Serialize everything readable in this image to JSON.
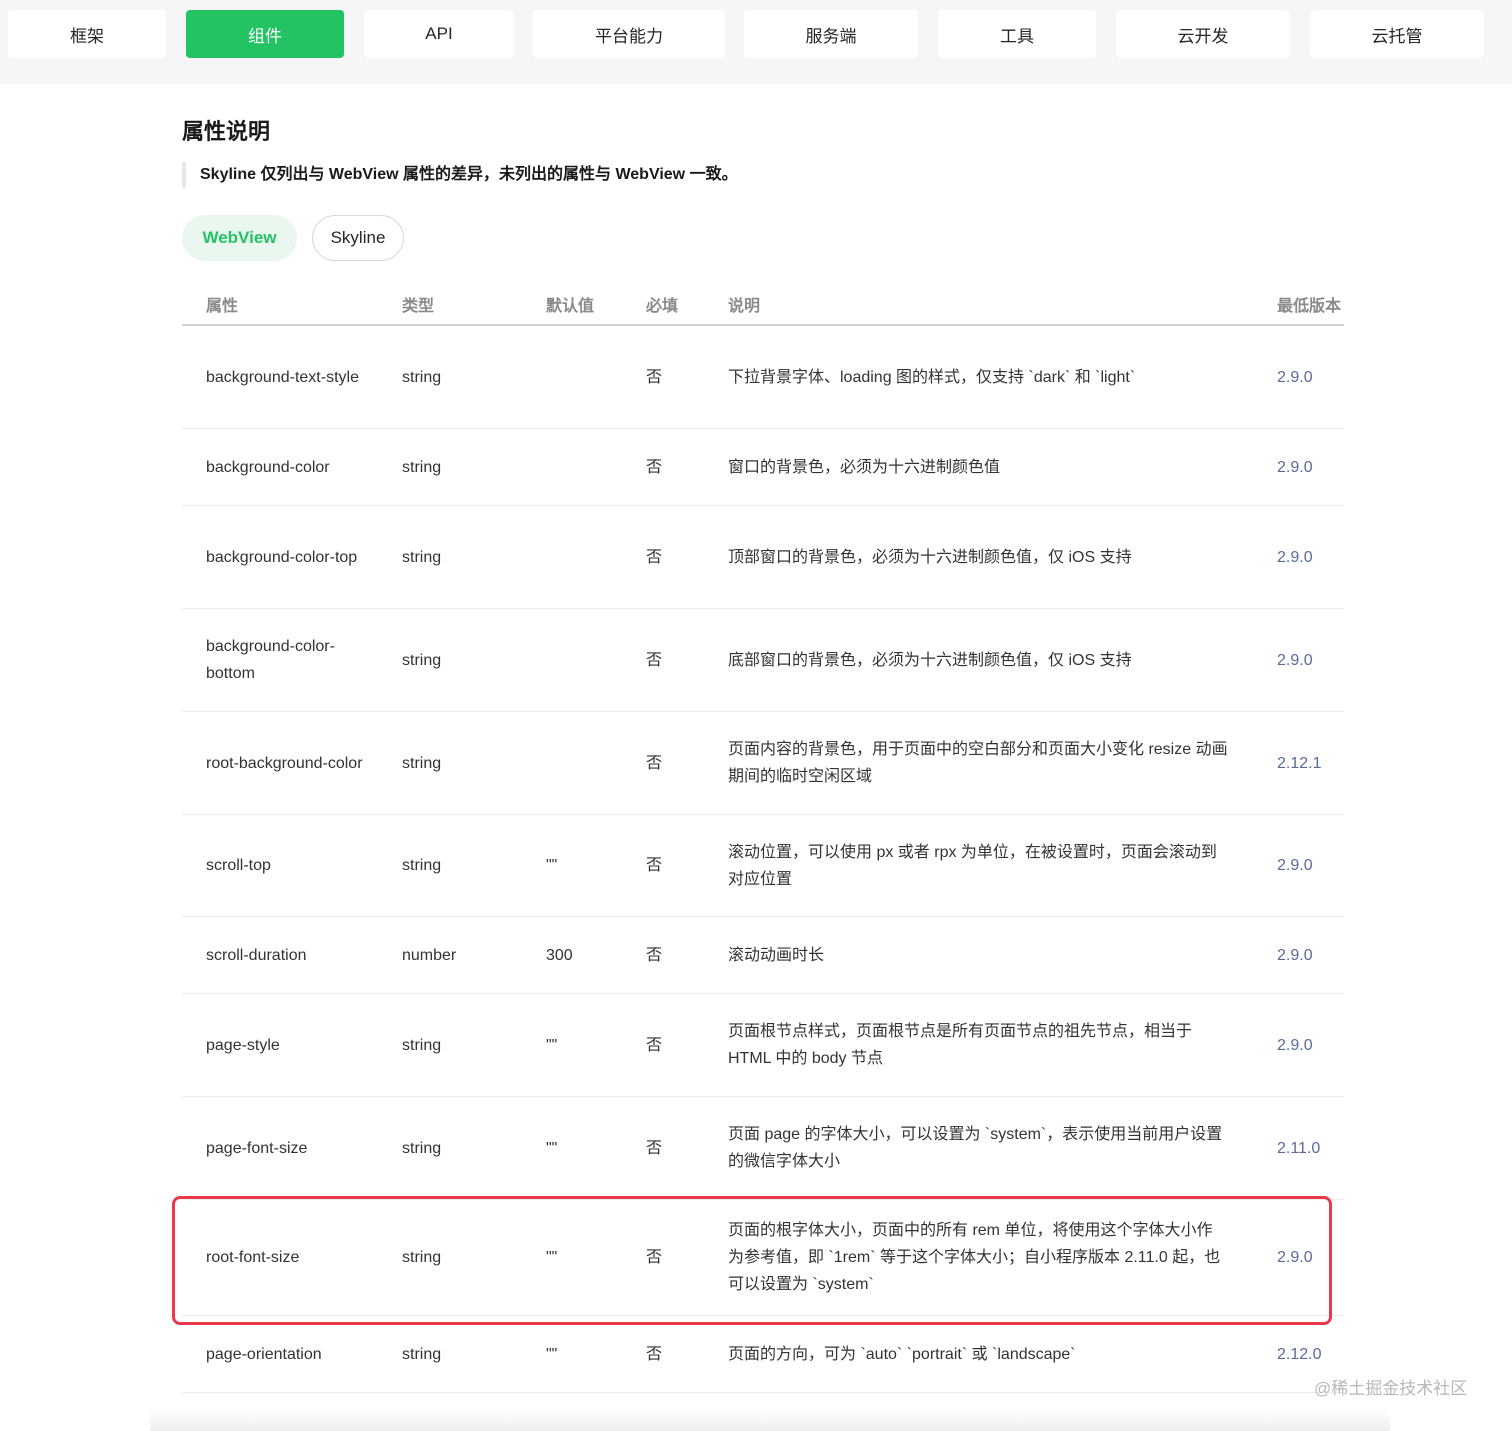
{
  "nav": {
    "tabs": [
      {
        "label": "框架"
      },
      {
        "label": "组件"
      },
      {
        "label": "API"
      },
      {
        "label": "平台能力"
      },
      {
        "label": "服务端"
      },
      {
        "label": "工具"
      },
      {
        "label": "云开发"
      },
      {
        "label": "云托管"
      }
    ],
    "active": "组件",
    "accent_color": "#23c263"
  },
  "section": {
    "title": "属性说明",
    "note": "Skyline 仅列出与 WebView 属性的差异，未列出的属性与 WebView 一致。"
  },
  "segmented": {
    "webview": "WebView",
    "skyline": "Skyline",
    "selected": "WebView"
  },
  "table": {
    "headers": {
      "attr": "属性",
      "type": "类型",
      "default": "默认值",
      "required": "必填",
      "desc": "说明",
      "version": "最低版本"
    },
    "rows": [
      {
        "attr": "background-text-style",
        "type": "string",
        "default": "",
        "required": "否",
        "desc": "下拉背景字体、loading 图的样式，仅支持 `dark` 和 `light`",
        "version": "2.9.0"
      },
      {
        "attr": "background-color",
        "type": "string",
        "default": "",
        "required": "否",
        "desc": "窗口的背景色，必须为十六进制颜色值",
        "version": "2.9.0"
      },
      {
        "attr": "background-color-top",
        "type": "string",
        "default": "",
        "required": "否",
        "desc": "顶部窗口的背景色，必须为十六进制颜色值，仅 iOS 支持",
        "version": "2.9.0"
      },
      {
        "attr": "background-color-bottom",
        "type": "string",
        "default": "",
        "required": "否",
        "desc": "底部窗口的背景色，必须为十六进制颜色值，仅 iOS 支持",
        "version": "2.9.0"
      },
      {
        "attr": "root-background-color",
        "type": "string",
        "default": "",
        "required": "否",
        "desc": "页面内容的背景色，用于页面中的空白部分和页面大小变化 resize 动画期间的临时空闲区域",
        "version": "2.12.1"
      },
      {
        "attr": "scroll-top",
        "type": "string",
        "default": "\"\"",
        "required": "否",
        "desc": "滚动位置，可以使用 px 或者 rpx 为单位，在被设置时，页面会滚动到对应位置",
        "version": "2.9.0"
      },
      {
        "attr": "scroll-duration",
        "type": "number",
        "default": "300",
        "required": "否",
        "desc": "滚动动画时长",
        "version": "2.9.0"
      },
      {
        "attr": "page-style",
        "type": "string",
        "default": "\"\"",
        "required": "否",
        "desc": "页面根节点样式，页面根节点是所有页面节点的祖先节点，相当于 HTML 中的 body 节点",
        "version": "2.9.0"
      },
      {
        "attr": "page-font-size",
        "type": "string",
        "default": "\"\"",
        "required": "否",
        "desc": "页面 page 的字体大小，可以设置为 `system`，表示使用当前用户设置的微信字体大小",
        "version": "2.11.0"
      },
      {
        "attr": "root-font-size",
        "type": "string",
        "default": "\"\"",
        "required": "否",
        "desc": "页面的根字体大小，页面中的所有 rem 单位，将使用这个字体大小作为参考值，即 `1rem` 等于这个字体大小；自小程序版本 2.11.0 起，也可以设置为 `system`",
        "version": "2.9.0"
      },
      {
        "attr": "page-orientation",
        "type": "string",
        "default": "\"\"",
        "required": "否",
        "desc": "页面的方向，可为 `auto` `portrait` 或 `landscape`",
        "version": "2.12.0"
      }
    ]
  },
  "watermark": "@稀土掘金技术社区",
  "highlight_color": "#e8394d"
}
